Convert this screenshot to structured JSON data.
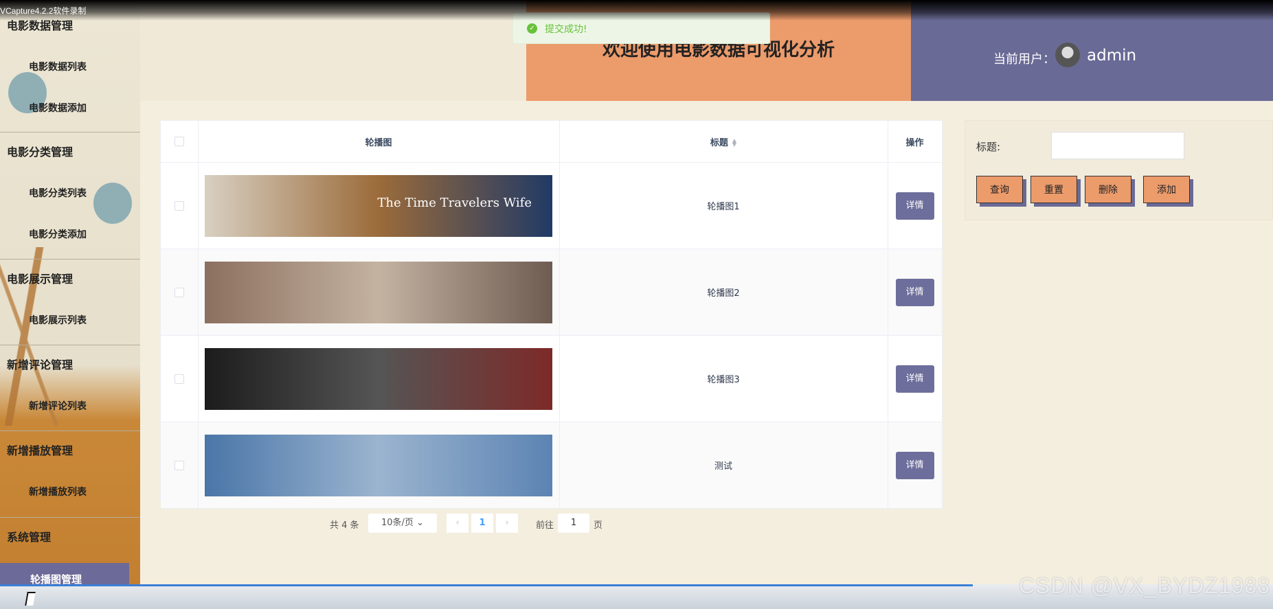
{
  "recorder": {
    "title": "VCapture4.2.2软件录制",
    "watermark": "CSDN @VX_BYDZ1988",
    "progress_fraction": 0.764
  },
  "sidebar": {
    "groups": [
      {
        "label": "电影数据管理",
        "items": [
          "电影数据列表",
          "电影数据添加"
        ]
      },
      {
        "label": "电影分类管理",
        "items": [
          "电影分类列表",
          "电影分类添加"
        ]
      },
      {
        "label": "电影展示管理",
        "items": [
          "电影展示列表"
        ]
      },
      {
        "label": "新增评论管理",
        "items": [
          "新增评论列表"
        ]
      },
      {
        "label": "新增播放管理",
        "items": [
          "新增播放列表"
        ]
      },
      {
        "label": "系统管理",
        "items": [
          "轮播图管理"
        ]
      }
    ],
    "active_item": "轮播图管理"
  },
  "header": {
    "title": "欢迎使用电影数据可视化分析",
    "user_label": "当前用户：",
    "user_name": "admin",
    "title_bg": "#ec9b6b",
    "user_bg": "#6a6a96"
  },
  "toast": {
    "text": "提交成功!",
    "icon": "success-check-icon"
  },
  "table": {
    "columns": [
      "轮播图",
      "标题",
      "操作"
    ],
    "rows": [
      {
        "title": "轮播图1",
        "action": "详情",
        "banner_text": "The Time Travelers Wife",
        "banner_colors": [
          "#d8d0c2",
          "#9b6b3a",
          "#213a66"
        ]
      },
      {
        "title": "轮播图2",
        "action": "详情",
        "banner_text": "",
        "banner_colors": [
          "#8c6f5f",
          "#c4b3a1",
          "#6e5c52"
        ]
      },
      {
        "title": "轮播图3",
        "action": "详情",
        "banner_text": "",
        "banner_colors": [
          "#1c1c1c",
          "#555",
          "#7d2a28"
        ]
      },
      {
        "title": "测试",
        "action": "详情",
        "banner_text": "",
        "banner_colors": [
          "#4a76a8",
          "#9bb4cf",
          "#5c84b3"
        ]
      }
    ]
  },
  "pagination": {
    "total": "共 4 条",
    "page_size": "10条/页",
    "current_page": "1",
    "goto_label": "前往",
    "goto_value": "1",
    "page_label": "页"
  },
  "search": {
    "label": "标题:",
    "buttons": [
      "查询",
      "重置",
      "删除",
      "添加"
    ],
    "button_color": "#ec9b6b"
  }
}
